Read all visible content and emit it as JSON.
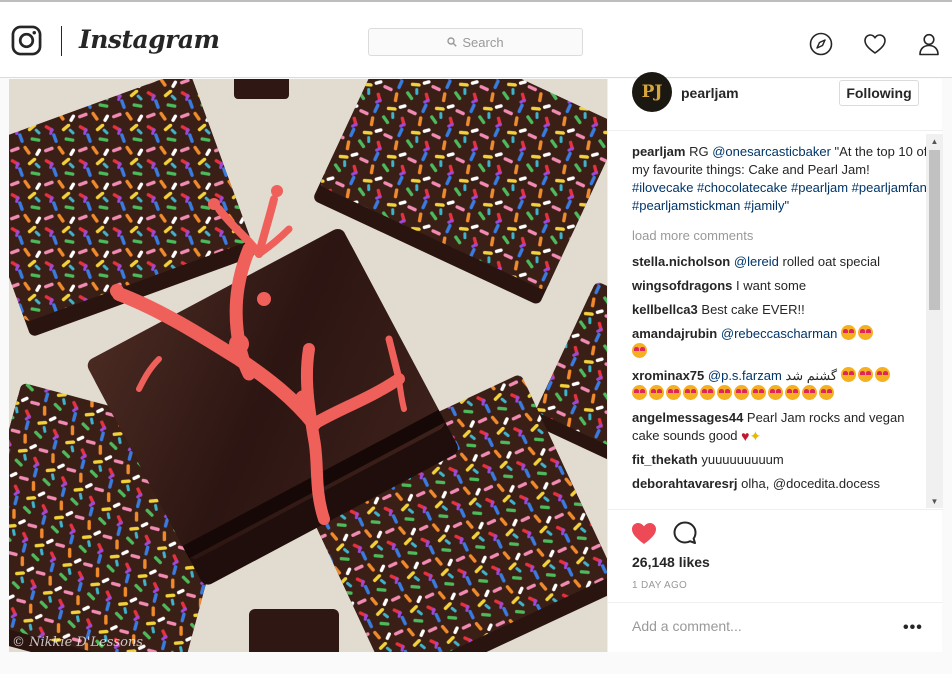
{
  "header": {
    "brand": "Instagram",
    "search_placeholder": "Search",
    "icons": [
      "instagram-logo-icon",
      "search-icon",
      "compass-icon",
      "heart-icon",
      "user-icon"
    ]
  },
  "photo": {
    "watermark": "© Nikkie D'Lessons"
  },
  "post": {
    "owner": {
      "username": "pearljam",
      "avatar_text": "PJ",
      "follow_label": "Following"
    },
    "caption": {
      "username": "pearljam",
      "text_prefix": "RG ",
      "mention": "@onesarcasticbaker",
      "text_suffix": " \"At the top 10 of my favourite things: Cake and Pearl Jam!",
      "hashtags": "#ilovecake #chocolatecake #pearljam #pearljamfan #pearljamstickman #jamily\""
    },
    "load_more": "load more comments",
    "comments": [
      {
        "user": "stella.nicholson",
        "mention": "@lereid",
        "text": " rolled oat special"
      },
      {
        "user": "wingsofdragons",
        "mention": "",
        "text": " I want some"
      },
      {
        "user": "kellbellca3",
        "mention": "",
        "text": " Best cake EVER!!"
      },
      {
        "user": "amandajrubin",
        "mention": "@rebeccascharman",
        "text": ""
      },
      {
        "user": "xrominax75",
        "mention": "@p.s.farzam",
        "text": " گشنم شد"
      },
      {
        "user": "angelmessages44",
        "mention": "",
        "text": " Pearl Jam rocks and vegan cake sounds good"
      },
      {
        "user": "fit_thekath",
        "mention": "",
        "text": " yuuuuuuuuum"
      },
      {
        "user": "deborahtavaresrj",
        "mention": "",
        "text": " olha, @docedita.docess"
      }
    ],
    "likes": "26,148 likes",
    "time": "1 DAY AGO",
    "add_comment_placeholder": "Add a comment...",
    "more_label": "•••"
  },
  "colors": {
    "liked_heart": "#ed4956",
    "mention": "#003569",
    "muted": "#999999"
  }
}
